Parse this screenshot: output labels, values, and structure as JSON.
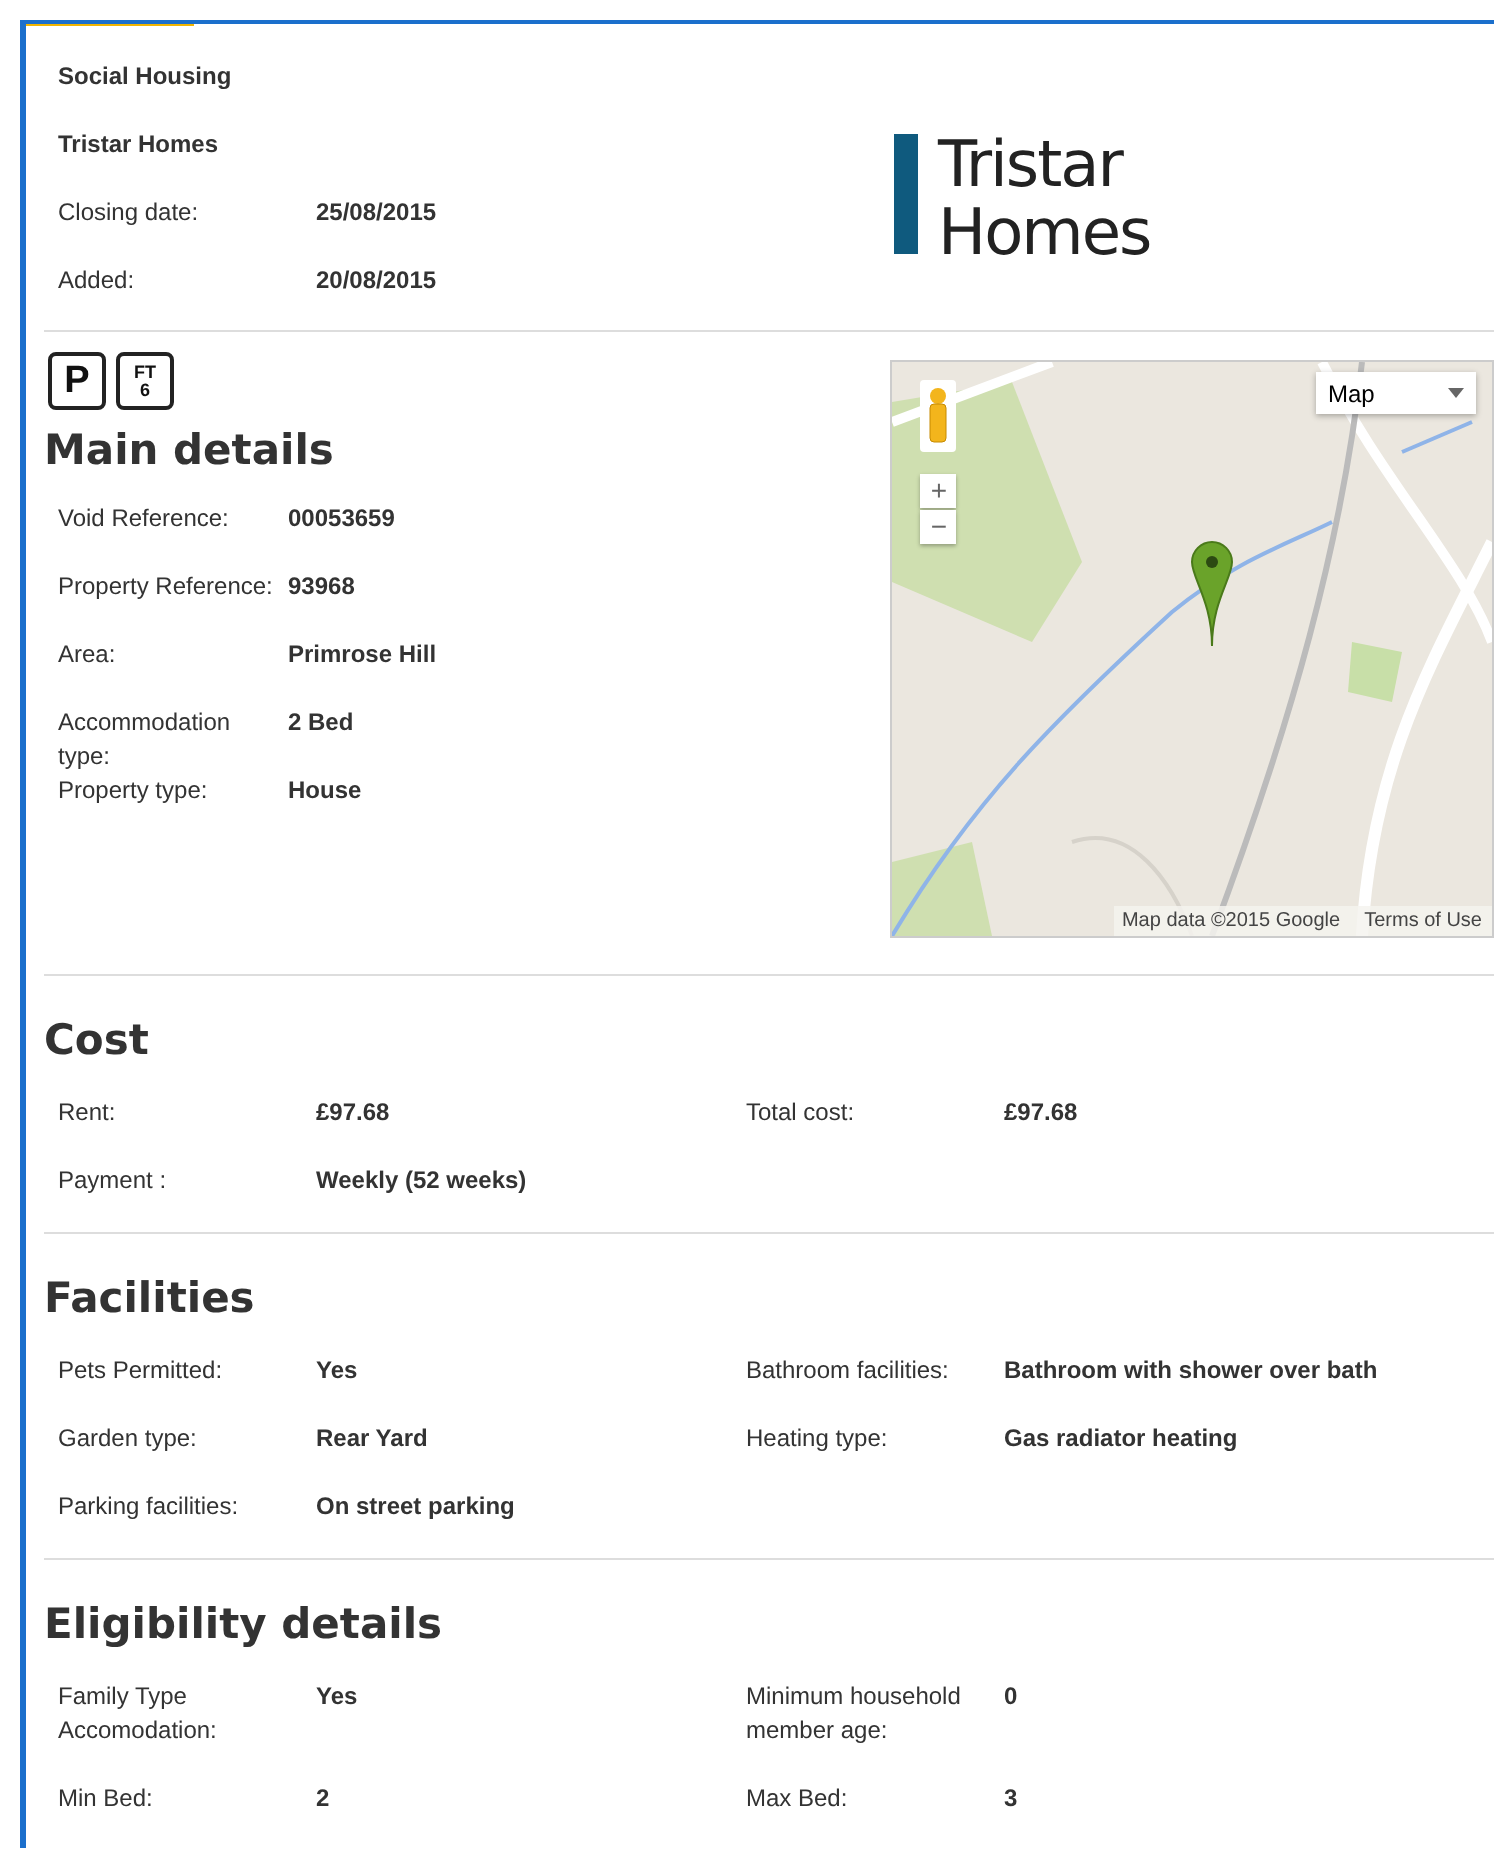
{
  "header": {
    "category": "Social Housing",
    "landlord": "Tristar Homes",
    "fields": [
      {
        "label": "Closing date:",
        "value": "25/08/2015"
      },
      {
        "label": "Added:",
        "value": "20/08/2015"
      }
    ],
    "logo_lines": [
      "Tristar",
      "Homes"
    ]
  },
  "badges": [
    {
      "lines": [
        "P"
      ]
    },
    {
      "lines": [
        "FT",
        "6"
      ]
    }
  ],
  "main_details": {
    "title": "Main details",
    "fields": [
      {
        "label": "Void Reference:",
        "value": "00053659"
      },
      {
        "label": "Property Reference:",
        "value": "93968"
      },
      {
        "label": "Area:",
        "value": "Primrose Hill"
      },
      {
        "label": "Accommodation type:",
        "value": "2 Bed"
      },
      {
        "label": "Property type:",
        "value": "House"
      }
    ]
  },
  "map": {
    "kind": "picture",
    "type_control": "Map",
    "zoom_in": "+",
    "zoom_out": "−",
    "attribution": "Map data ©2015 Google",
    "terms": "Terms of Use"
  },
  "sections": [
    {
      "title": "Cost",
      "rows": [
        [
          {
            "label": "Rent:",
            "value": "£97.68"
          },
          {
            "label": "Total cost:",
            "value": "£97.68"
          }
        ],
        [
          {
            "label": "Payment :",
            "value": "Weekly (52 weeks)"
          }
        ]
      ]
    },
    {
      "title": "Facilities",
      "rows": [
        [
          {
            "label": "Pets Permitted:",
            "value": "Yes"
          },
          {
            "label": "Bathroom facilities:",
            "value": "Bathroom with shower over bath"
          }
        ],
        [
          {
            "label": "Garden type:",
            "value": "Rear Yard"
          },
          {
            "label": "Heating type:",
            "value": "Gas radiator heating"
          }
        ],
        [
          {
            "label": "Parking facilities:",
            "value": "On street parking"
          }
        ]
      ]
    },
    {
      "title": "Eligibility details",
      "rows": [
        [
          {
            "label": "Family Type Accomodation:",
            "value": "Yes"
          },
          {
            "label": "Minimum household member age:",
            "value": "0"
          }
        ],
        [
          {
            "label": "Min Bed:",
            "value": "2"
          },
          {
            "label": "Max Bed:",
            "value": "3"
          }
        ]
      ]
    }
  ]
}
